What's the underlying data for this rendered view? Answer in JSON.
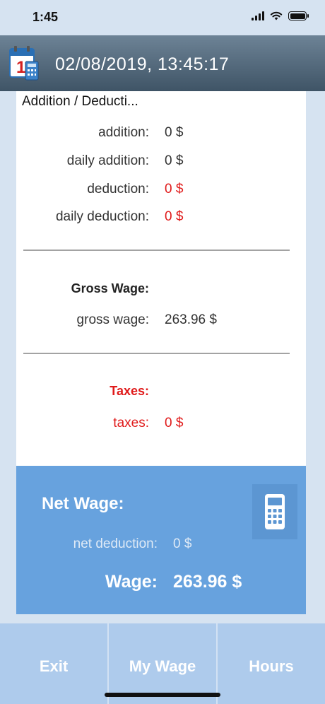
{
  "status": {
    "time": "1:45"
  },
  "header": {
    "title": "02/08/2019, 13:45:17",
    "icon_number": "1"
  },
  "add_deduct": {
    "title": "Addition / Deducti...",
    "rows": [
      {
        "label": "addition:",
        "value": "0 $"
      },
      {
        "label": "daily addition:",
        "value": "0 $"
      },
      {
        "label": "deduction:",
        "value": "0 $"
      },
      {
        "label": "daily deduction:",
        "value": "0 $"
      }
    ]
  },
  "gross": {
    "title": "Gross Wage:",
    "label": "gross wage:",
    "value": "263.96 $"
  },
  "taxes": {
    "title": "Taxes:",
    "label": "taxes:",
    "value": "0 $"
  },
  "net": {
    "title": "Net Wage:",
    "deduction_label": "net deduction:",
    "deduction_value": "0 $",
    "wage_label": "Wage:",
    "wage_value": "263.96 $"
  },
  "tabs": [
    {
      "label": "Exit"
    },
    {
      "label": "My Wage"
    },
    {
      "label": "Hours"
    }
  ],
  "colors": {
    "header": "#4f6577",
    "panel": "#67a2de",
    "tabbar": "#aecbec",
    "negative": "#e01b1b"
  }
}
